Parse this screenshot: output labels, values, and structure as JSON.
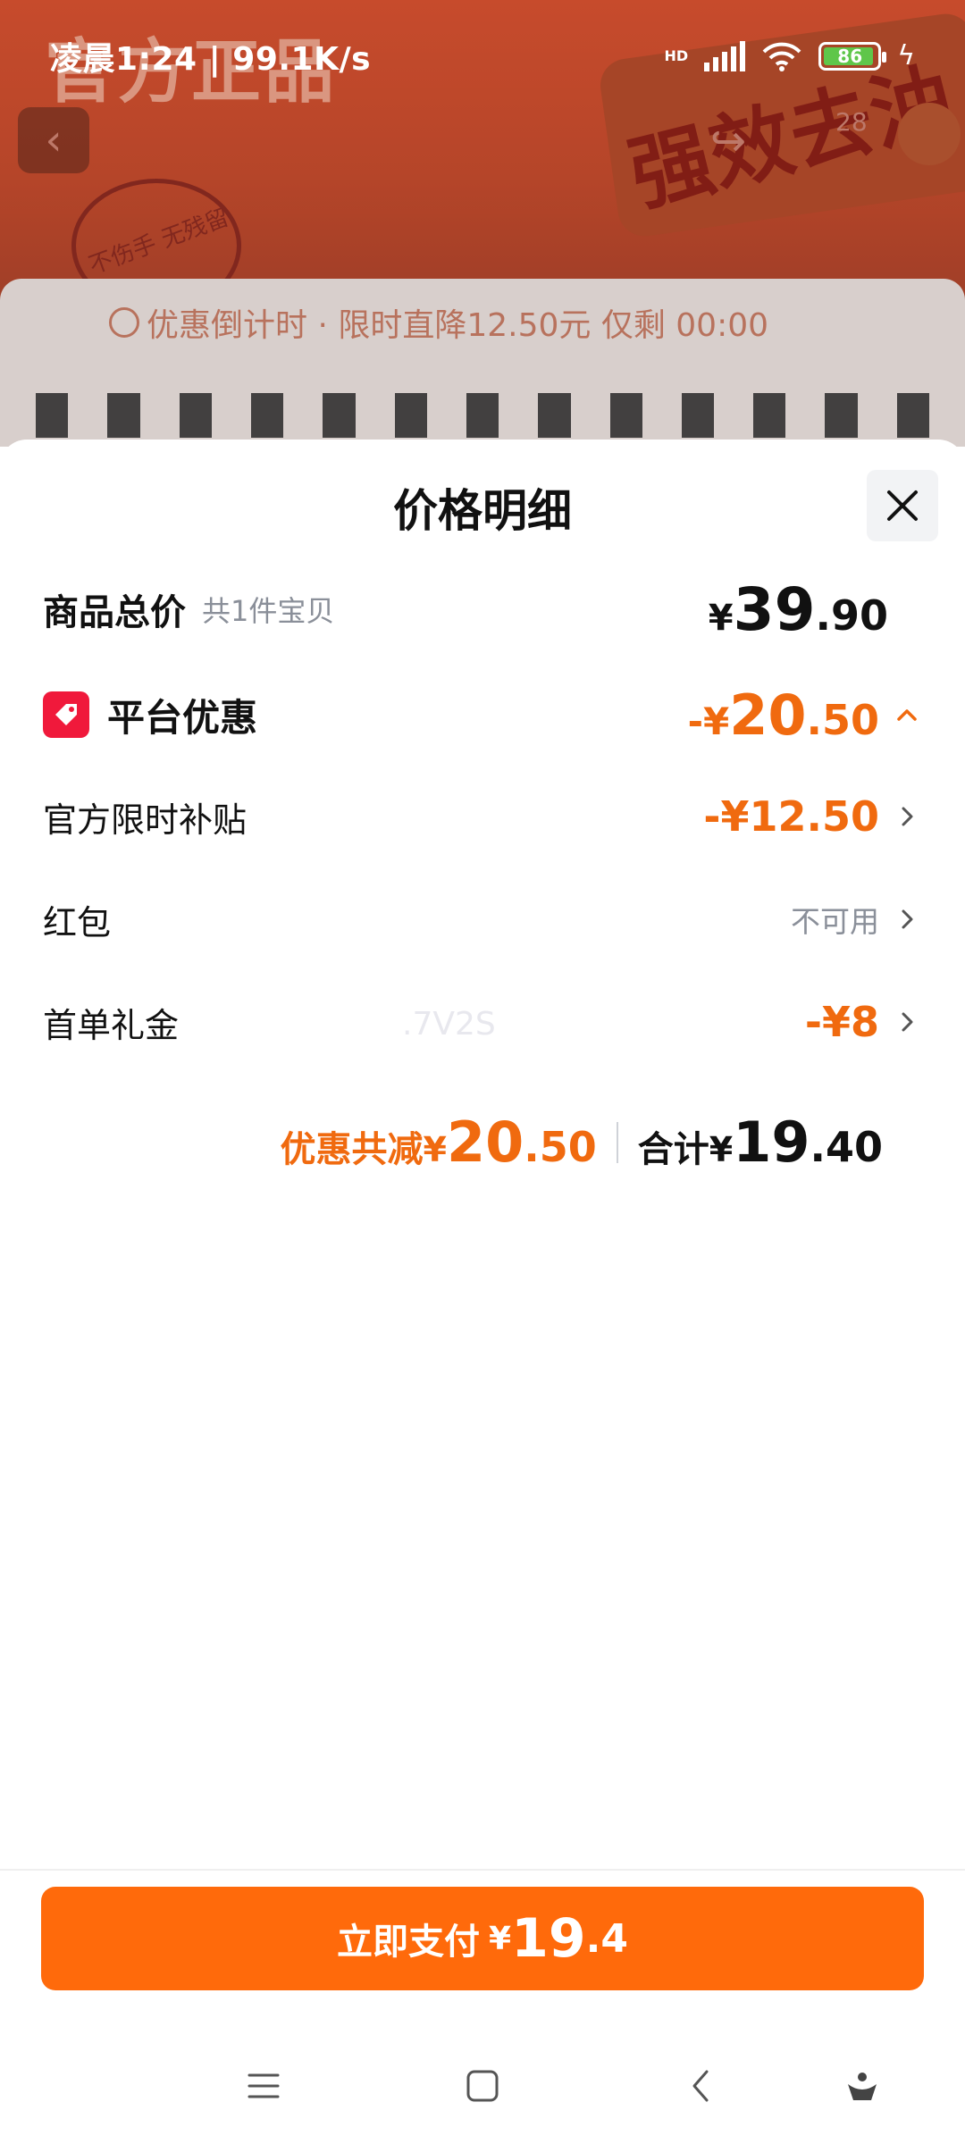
{
  "status_bar": {
    "time": "凌晨1:24",
    "speed": "99.1K/s",
    "network": "HD",
    "battery": "86",
    "battery_level": 0.86
  },
  "background": {
    "banner_text": "官方正品",
    "badge_text": "强效去油",
    "seal_text": "不伤手 无残留",
    "share_count": "28",
    "countdown_text": "优惠倒计时 · 限时直降12.50元 仅剩 00:00"
  },
  "sheet": {
    "title": "价格明细",
    "close_icon": "close-icon",
    "goods_total": {
      "label": "商品总价",
      "sub": "共1件宝贝",
      "currency": "¥",
      "int": "39",
      "dec": ".90"
    },
    "platform_discount": {
      "label": "平台优惠",
      "prefix": "-¥",
      "int": "20",
      "dec": ".50",
      "icon": "tag-icon",
      "expanded": true
    },
    "items": [
      {
        "label": "官方限时补贴",
        "value": "-¥12.50",
        "type": "discount"
      },
      {
        "label": "红包",
        "value": "不可用",
        "type": "unavailable"
      },
      {
        "label": "首单礼金",
        "value": "-¥8",
        "type": "discount"
      }
    ],
    "watermark": ".7V2S",
    "summary": {
      "discount_label": "优惠共减",
      "discount_currency": "¥",
      "discount_int": "20",
      "discount_dec": ".50",
      "total_label": "合计",
      "total_currency": "¥",
      "total_int": "19",
      "total_dec": ".40"
    }
  },
  "pay_button": {
    "label": "立即支付",
    "currency": "¥",
    "int": "19",
    "dec": ".4"
  },
  "navbar": {
    "icons": [
      "menu-icon",
      "home-icon",
      "back-icon",
      "assistant-icon"
    ]
  },
  "colors": {
    "accent": "#ff6a0b",
    "discount_text": "#f06a0f",
    "tag_red": "#f0193b",
    "muted_text": "#8a8f99"
  }
}
